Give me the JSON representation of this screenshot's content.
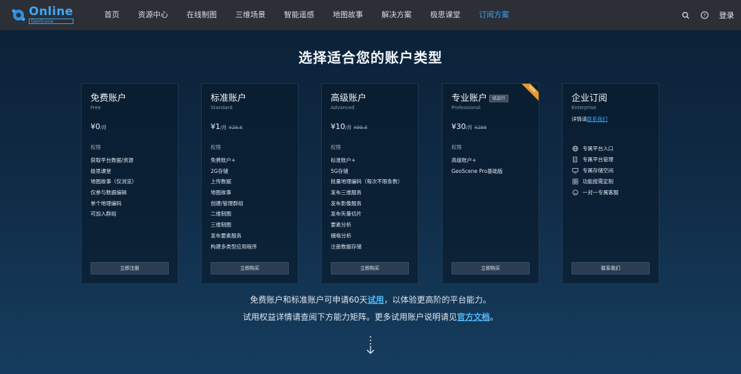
{
  "header": {
    "logo": {
      "main": "Online",
      "sub": "GeoScene"
    },
    "nav": [
      {
        "label": "首页",
        "active": false
      },
      {
        "label": "资源中心",
        "active": false
      },
      {
        "label": "在线制图",
        "active": false
      },
      {
        "label": "三维场景",
        "active": false
      },
      {
        "label": "智能遥感",
        "active": false
      },
      {
        "label": "地图故事",
        "active": false
      },
      {
        "label": "解决方案",
        "active": false
      },
      {
        "label": "极思课堂",
        "active": false
      },
      {
        "label": "订阅方案",
        "active": true
      }
    ],
    "login_label": "登录",
    "accent_color": "#3aa3f6"
  },
  "headline": "选择适合您的账户类型",
  "plans": [
    {
      "title": "免费账户",
      "subtitle": "Free",
      "price": "¥0",
      "unit": "/月",
      "old_price": "",
      "section_label": "权限",
      "features": [
        "获取平台数据/资源",
        "极思课堂",
        "地图故事（仅浏览）",
        "仅参与数据编辑",
        "单个地理编码",
        "可加入群组"
      ],
      "button": "立即注册"
    },
    {
      "title": "标准账户",
      "subtitle": "Standard",
      "price": "¥1",
      "unit": "/月",
      "old_price": "¥29.8",
      "section_label": "权限",
      "features": [
        "免费账户+",
        "2G存储",
        "上传数据",
        "地图故事",
        "创建/管理群组",
        "二维制图",
        "三维制图",
        "发布要素服务",
        "构建多类型应用程序"
      ],
      "button": "立即购买"
    },
    {
      "title": "高级账户",
      "subtitle": "Advanced",
      "price": "¥10",
      "unit": "/月",
      "old_price": "¥99.8",
      "section_label": "权限",
      "features": [
        "标准账户+",
        "5G存储",
        "批量地理编码（每次不限条数）",
        "发布三维服务",
        "发布影像服务",
        "发布矢量切片",
        "要素分析",
        "栅格分析",
        "注册数据存储"
      ],
      "button": "立即购买"
    },
    {
      "title": "专业账户",
      "subtitle": "Professional",
      "badge": "试运行",
      "ribbon": "NEW",
      "price": "¥30",
      "unit": "/月",
      "old_price": "¥298",
      "section_label": "权限",
      "features": [
        "高级账户+",
        "GeoScene Pro基础版"
      ],
      "button": "立即购买"
    },
    {
      "title": "企业订阅",
      "subtitle": "Enterprise",
      "detail_prefix": "详情请",
      "detail_link": "联系我们",
      "features": [
        {
          "icon": "globe-icon",
          "label": "专属平台入口"
        },
        {
          "icon": "server-icon",
          "label": "专属平台管理"
        },
        {
          "icon": "monitor-icon",
          "label": "专属存储空间"
        },
        {
          "icon": "grid-icon",
          "label": "功能按需定制"
        },
        {
          "icon": "smile-icon",
          "label": "一对一专属客服"
        }
      ],
      "button": "联系我们"
    }
  ],
  "footer": {
    "line1_prefix": "免费账户和标准账户可申请60天",
    "line1_link": "试用",
    "line1_suffix": "，以体验更高阶的平台能力。",
    "line2_prefix": "试用权益详情请查阅下方能力矩阵。更多试用账户说明请见",
    "line2_link": "官方文档",
    "line2_suffix": "。"
  }
}
